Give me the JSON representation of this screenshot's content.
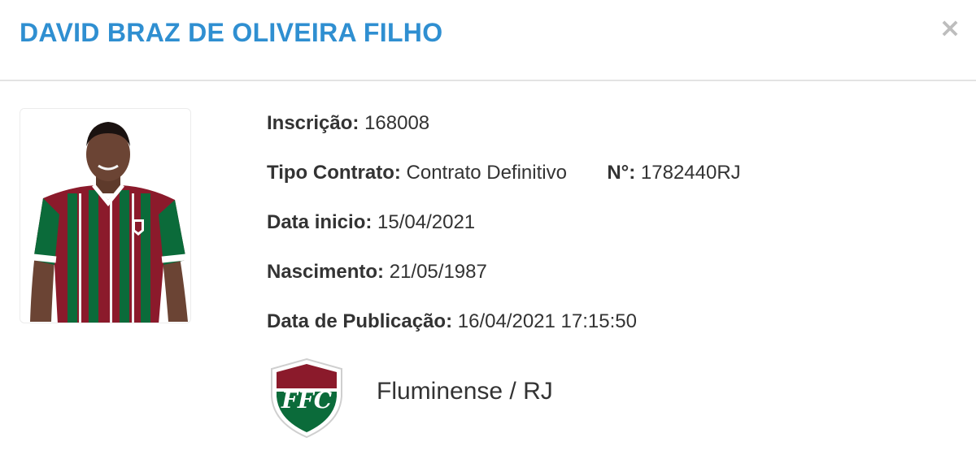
{
  "header": {
    "title": "DAVID BRAZ DE OLIVEIRA FILHO",
    "close_label": "×"
  },
  "player": {
    "inscricao_label": "Inscrição:",
    "inscricao_value": "168008",
    "tipo_contrato_label": "Tipo Contrato:",
    "tipo_contrato_value": "Contrato Definitivo",
    "numero_label": "N°:",
    "numero_value": "1782440RJ",
    "data_inicio_label": "Data inicio:",
    "data_inicio_value": "15/04/2021",
    "nascimento_label": "Nascimento:",
    "nascimento_value": "21/05/1987",
    "publicacao_label": "Data de Publicação:",
    "publicacao_value": "16/04/2021 17:15:50"
  },
  "club": {
    "name": "Fluminense / RJ",
    "crest_icon": "fluminense-crest-icon",
    "crest_text": "FFC"
  },
  "colors": {
    "title": "#2f8fd1",
    "club_grena": "#8b1a2b",
    "club_green": "#0b6b3a"
  }
}
